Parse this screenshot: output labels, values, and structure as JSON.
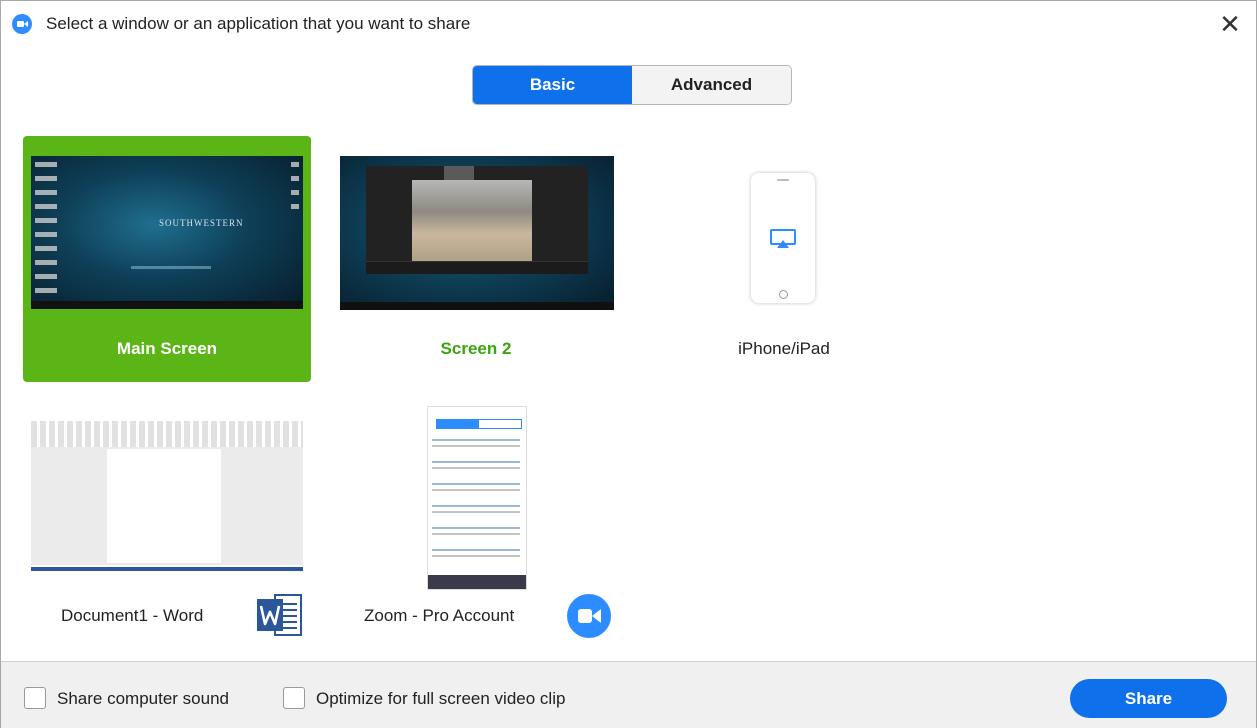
{
  "window": {
    "title": "Select a window or an application that you want to share",
    "close_glyph": "✕"
  },
  "tabs": [
    {
      "label": "Basic",
      "selected": true
    },
    {
      "label": "Advanced",
      "selected": false
    }
  ],
  "share_options": [
    {
      "label": "Main Screen",
      "selected": true,
      "thumbnail": "desktop-screenshot",
      "thumb_text": "SOUTHWESTERN"
    },
    {
      "label": "Screen 2",
      "selected": false,
      "thumbnail": "zoom-meeting-screenshot"
    },
    {
      "label": "iPhone/iPad",
      "selected": false,
      "thumbnail": "phone-airplay-icon"
    },
    {
      "label": "Document1 - Word",
      "selected": false,
      "thumbnail": "word-document-screenshot",
      "app_icon": "word-icon"
    },
    {
      "label": "Zoom - Pro Account",
      "selected": false,
      "thumbnail": "zoom-app-screenshot",
      "app_icon": "zoom-icon"
    }
  ],
  "footer": {
    "share_sound_label": "Share computer sound",
    "share_sound_checked": false,
    "optimize_label": "Optimize for full screen video clip",
    "optimize_checked": false,
    "share_button": "Share"
  },
  "colors": {
    "accent_blue": "#0e71eb",
    "selected_green": "#5cb517",
    "label_green": "#3aa60f",
    "zoom_blue": "#2d8cff",
    "word_blue": "#2b579a"
  }
}
